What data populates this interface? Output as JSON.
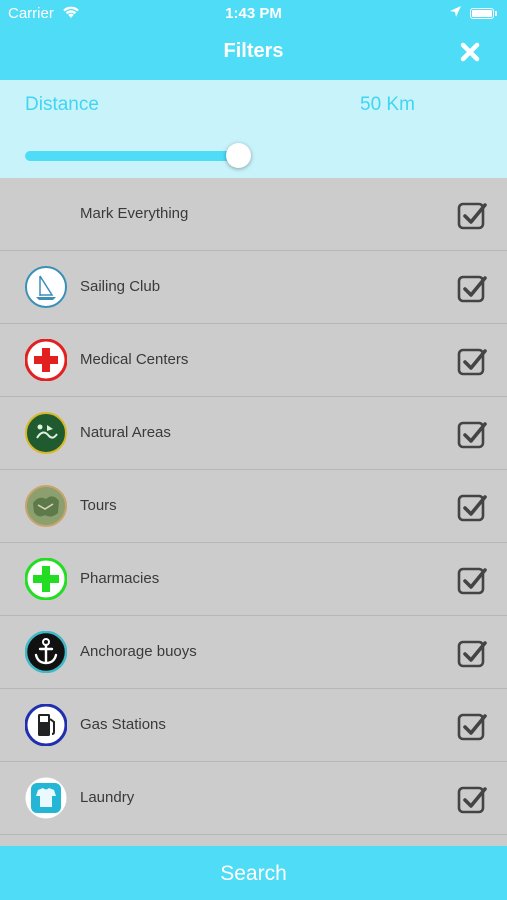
{
  "status_bar": {
    "carrier": "Carrier",
    "time": "1:43 PM"
  },
  "header": {
    "title": "Filters",
    "close_icon": "close-icon"
  },
  "distance": {
    "label": "Distance",
    "value": "50 Km",
    "slider_level_percent": 100
  },
  "filters": {
    "mark_all": {
      "label": "Mark Everything",
      "checked": true
    },
    "items": [
      {
        "label": "Sailing Club",
        "icon": "sailing-club-icon",
        "checked": true
      },
      {
        "label": "Medical Centers",
        "icon": "medical-center-icon",
        "checked": true
      },
      {
        "label": "Natural Areas",
        "icon": "natural-areas-icon",
        "checked": true
      },
      {
        "label": "Tours",
        "icon": "tours-icon",
        "checked": true
      },
      {
        "label": "Pharmacies",
        "icon": "pharmacy-icon",
        "checked": true
      },
      {
        "label": "Anchorage buoys",
        "icon": "anchor-icon",
        "checked": true
      },
      {
        "label": "Gas Stations",
        "icon": "gas-station-icon",
        "checked": true
      },
      {
        "label": "Laundry",
        "icon": "laundry-icon",
        "checked": true
      }
    ]
  },
  "footer": {
    "search_label": "Search"
  },
  "colors": {
    "accent": "#4fdcf6",
    "panel": "#c9f3fb",
    "list_bg": "#cccccc",
    "text": "#3a3a3a"
  }
}
